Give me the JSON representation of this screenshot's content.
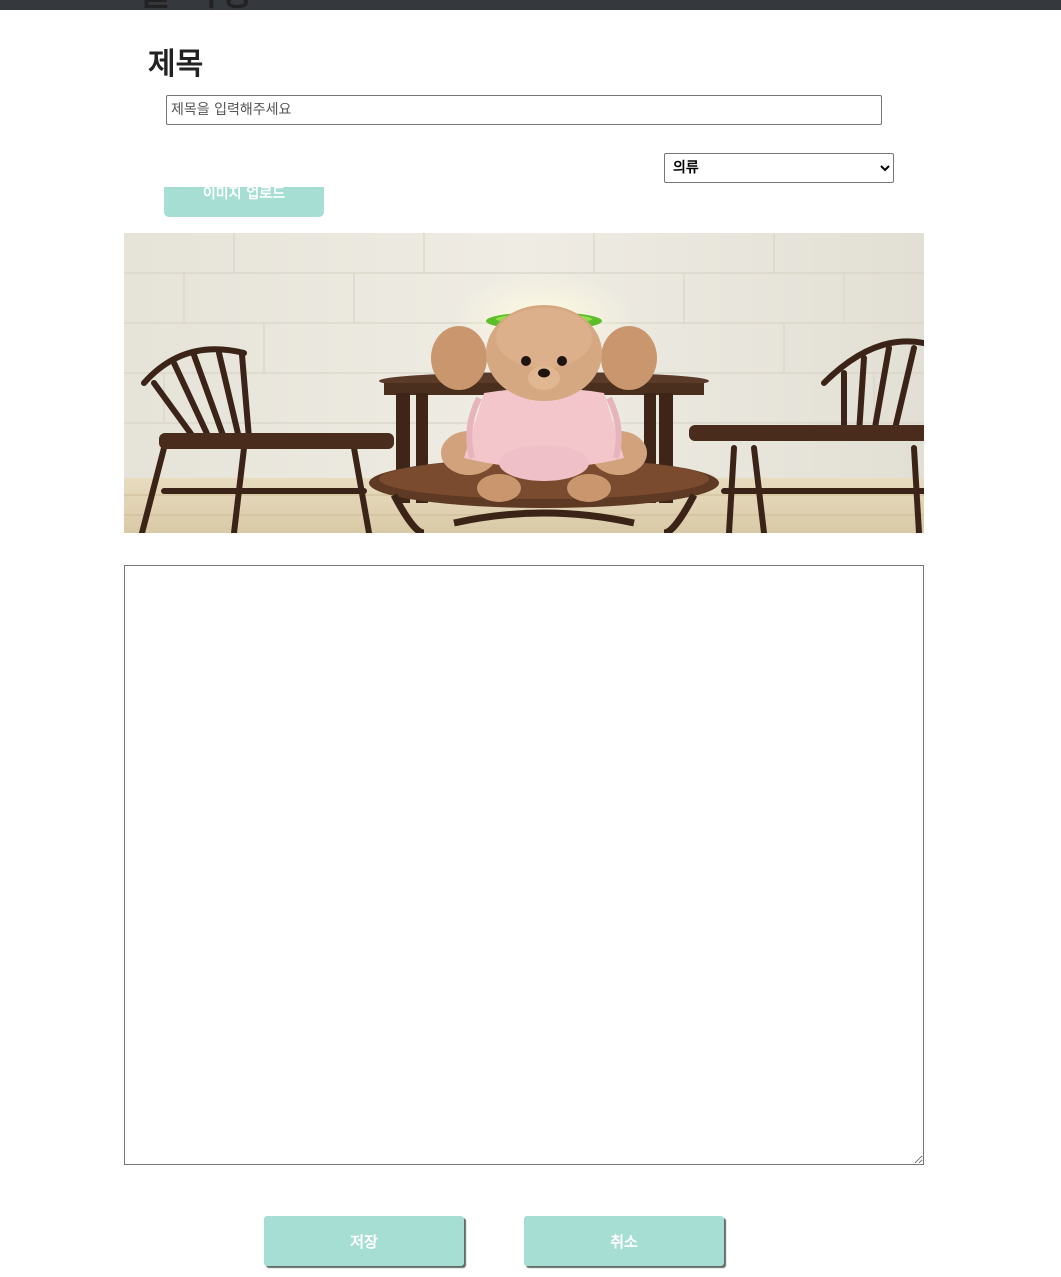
{
  "header": {
    "cut_title": "글 작성"
  },
  "form": {
    "title_label": "제목",
    "title_input": {
      "value": "",
      "placeholder": "제목을 입력해주세요"
    },
    "category_select": {
      "selected": "의류",
      "options": [
        "의류"
      ]
    },
    "upload_button_label": "이미지 업로드",
    "preview_image": {
      "description_icon": "image-preview"
    },
    "content_textarea": {
      "value": ""
    },
    "save_label": "저장",
    "cancel_label": "취소"
  },
  "colors": {
    "accent": "#a6ded4",
    "topbar": "#35383d"
  }
}
